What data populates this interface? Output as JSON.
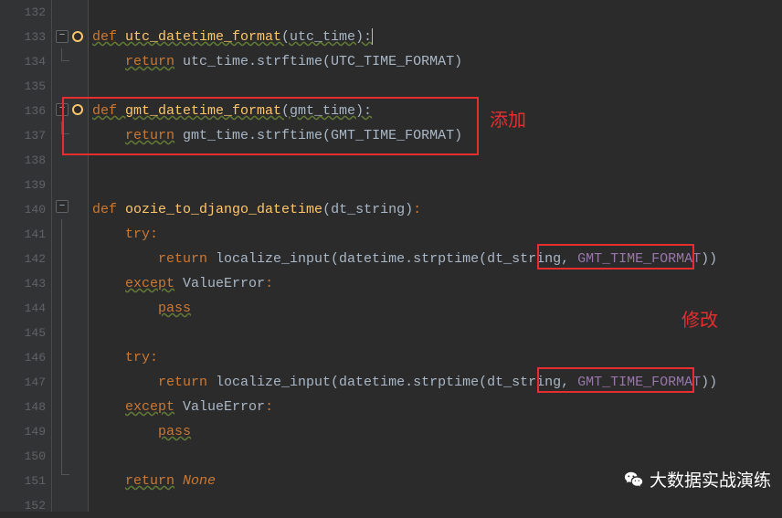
{
  "lines": {
    "132": "132",
    "133": "133",
    "134": "134",
    "135": "135",
    "136": "136",
    "137": "137",
    "138": "138",
    "139": "139",
    "140": "140",
    "141": "141",
    "142": "142",
    "143": "143",
    "144": "144",
    "145": "145",
    "146": "146",
    "147": "147",
    "148": "148",
    "149": "149",
    "150": "150",
    "151": "151",
    "152": "152"
  },
  "annotations": {
    "add_label": "添加",
    "modify_label": "修改"
  },
  "code": {
    "l133_def": "def ",
    "l133_fn": "utc_datetime_format",
    "l133_rest": "(utc_time):",
    "l134_ret": "return",
    "l134_body": " utc_time.strftime(UTC_TIME_FORMAT)",
    "l136_def": "def ",
    "l136_fn": "gmt_datetime_format",
    "l136_rest": "(gmt_time):",
    "l137_ret": "return",
    "l137_body": " gmt_time.strftime(GMT_TIME_FORMAT)",
    "l140_def": "def ",
    "l140_fn": "oozie_to_django_datetime",
    "l140_rest": "(dt_string)",
    "l140_colon": ":",
    "l141_try": "try",
    "l141_colon": ":",
    "l142_ret": "return",
    "l142_body": " localize_input(datetime.strptime(dt_string,",
    "l142_space": " ",
    "l142_const": "GMT_TIME_FORMAT",
    "l142_close": "))",
    "l143_except": "except",
    "l143_val": " ValueError",
    "l143_colon": ":",
    "l144_pass": "pass",
    "l146_try": "try",
    "l146_colon": ":",
    "l147_ret": "return",
    "l147_body": " localize_input(datetime.strptime(dt_string,",
    "l147_space": " ",
    "l147_const": "GMT_TIME_FORMAT",
    "l147_close": "))",
    "l148_except": "except",
    "l148_val": " ValueError",
    "l148_colon": ":",
    "l149_pass": "pass",
    "l151_ret": "return",
    "l151_none": " None"
  },
  "indents": {
    "ind4": "    ",
    "ind8": "        ",
    "ind12": "            "
  },
  "watermark": "大数据实战演练"
}
